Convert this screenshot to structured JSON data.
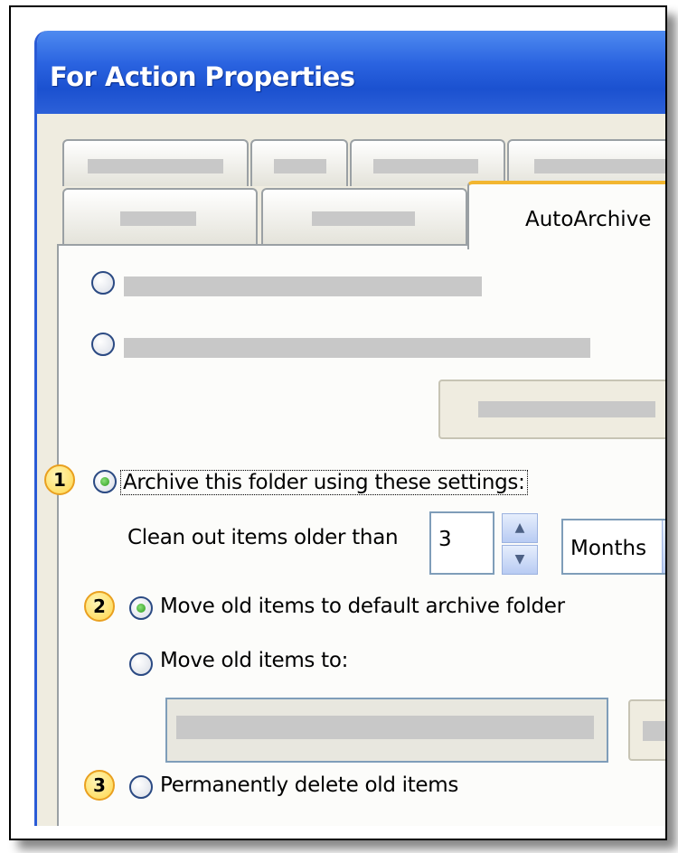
{
  "window": {
    "title": "For Action Properties"
  },
  "tabs": {
    "active_label": "AutoArchive"
  },
  "autoarchive": {
    "archive_option_label": "Archive this folder using these settings:",
    "clean_out_label": "Clean out items older than",
    "age_value": "3",
    "age_unit": "Months",
    "move_default_label": "Move old items to default archive folder",
    "move_to_label": "Move old items to:",
    "delete_label": "Permanently delete old items"
  },
  "callouts": [
    "1",
    "2",
    "3"
  ],
  "colors": {
    "titlebar": "#2a63e0",
    "active_tab_accent": "#f2b630",
    "callout_fill": "#ffd64a"
  }
}
